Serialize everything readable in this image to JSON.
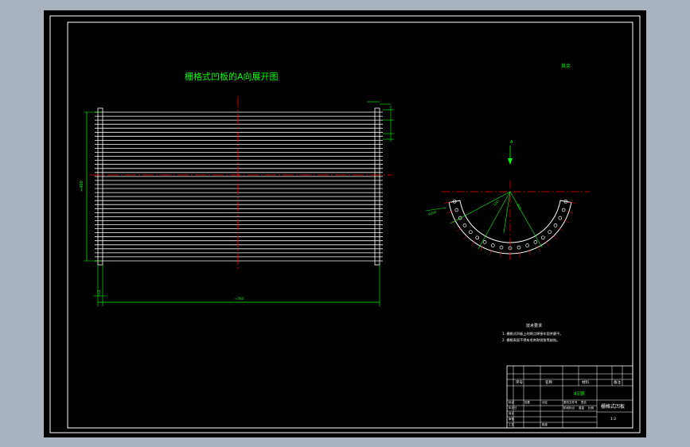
{
  "colors": {
    "background_outer": "#a9b2bf",
    "model_space": "#000000",
    "frame": "#ffffff",
    "dimension": "#00ff00",
    "center_line": "#ff0000",
    "title_text": "#00ff00",
    "note_text": "#ffffff"
  },
  "drawing": {
    "view_title": "栅格式凹板的A向展开图",
    "left_dim_label": "≈460",
    "bottom_dim_small": "≈12",
    "bottom_dim_main": "≈760",
    "top_right_mark": "其余",
    "view_arrow_label": "A",
    "arc_angle_labels": [
      "120°",
      "Φ15",
      "R150"
    ]
  },
  "notes": {
    "heading": "技术要求",
    "line1": "1. 栅格式凹板上的焊点焊接牢固并磨平。",
    "line2": "2. 栅格表面不得有毛刺和锐角等缺陷。"
  },
  "title_block": {
    "part_name": "栅格式凹板",
    "material": "45钢",
    "scale": "1:2",
    "row_labels": [
      "序号",
      "名称",
      "材料",
      "备注"
    ],
    "cells": [
      "标记",
      "处数",
      "分区",
      "更改文件号",
      "签名",
      "年月日",
      "设计",
      "审核",
      "工艺",
      "批准",
      "阶段标记",
      "重量",
      "比例"
    ]
  }
}
